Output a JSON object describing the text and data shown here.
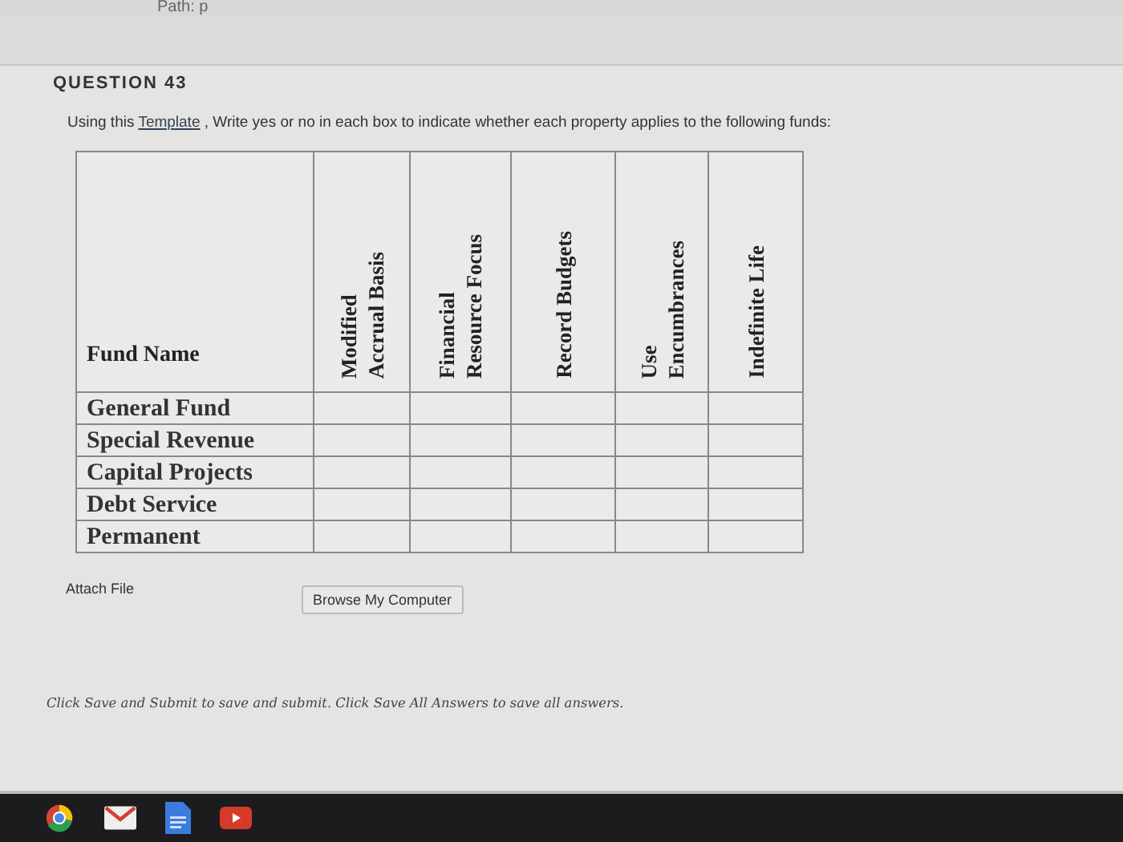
{
  "path_text": "Path: p",
  "question": {
    "title": "QUESTION 43",
    "instruction_before": "Using this",
    "link": "Template",
    "instruction_after": ", Write yes or no in each box to indicate whether each property applies to the following funds:"
  },
  "table": {
    "columns": [
      {
        "lines": [
          "Fund Name"
        ]
      },
      {
        "lines": [
          "Modified",
          "Accrual Basis"
        ]
      },
      {
        "lines": [
          "Financial",
          "Resource Focus"
        ]
      },
      {
        "lines": [
          "Record Budgets"
        ]
      },
      {
        "lines": [
          "Use",
          "Encumbrances"
        ]
      },
      {
        "lines": [
          "Indefinite Life"
        ]
      }
    ],
    "rows": [
      "General Fund",
      "Special Revenue",
      "Capital Projects",
      "Debt Service",
      "Permanent"
    ]
  },
  "attach": {
    "label": "Attach File",
    "button": "Browse My Computer"
  },
  "footer_note": "Click Save and Submit to save and submit. Click Save All Answers to save all answers."
}
